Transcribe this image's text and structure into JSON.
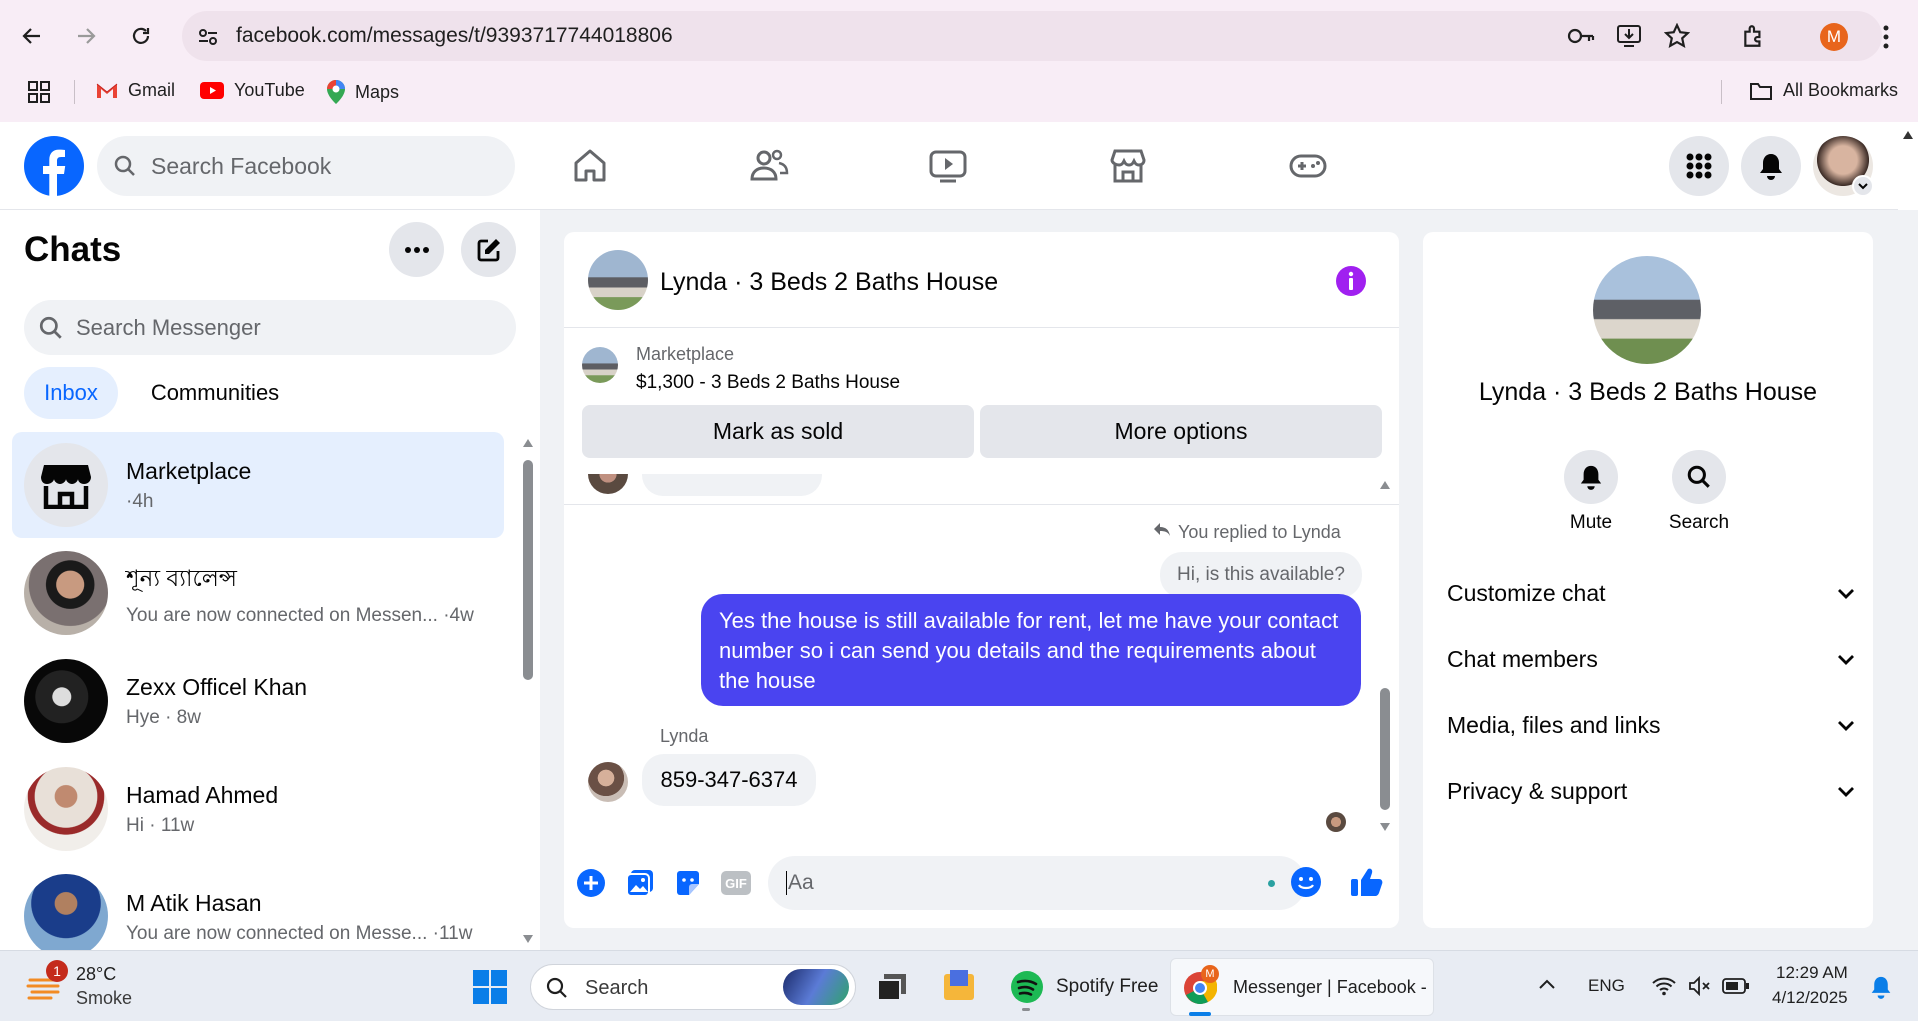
{
  "browser": {
    "url": "facebook.com/messages/t/9393717744018806",
    "profile_initial": "M",
    "bookmarks": [
      {
        "label": "Gmail"
      },
      {
        "label": "YouTube"
      },
      {
        "label": "Maps"
      }
    ],
    "all_bookmarks": "All Bookmarks"
  },
  "fb": {
    "search_placeholder": "Search Facebook"
  },
  "chats": {
    "title": "Chats",
    "search_placeholder": "Search Messenger",
    "tabs": [
      {
        "label": "Inbox"
      },
      {
        "label": "Communities"
      }
    ],
    "items": [
      {
        "name": "Marketplace",
        "sub": "·4h"
      },
      {
        "name": "শূন্য ব্যালেন্স",
        "sub": "You are now connected on Messen... ·4w"
      },
      {
        "name": "Zexx Officel Khan",
        "sub": "Hye · 8w"
      },
      {
        "name": "Hamad Ahmed",
        "sub": "Hi · 11w"
      },
      {
        "name": "M Atik Hasan",
        "sub": "You are now connected on Messe... ·11w"
      }
    ]
  },
  "conversation": {
    "title": "Lynda · 3 Beds 2 Baths House",
    "marketplace_label": "Marketplace",
    "listing": "$1,300 - 3 Beds 2 Baths House",
    "mark_sold": "Mark as sold",
    "more_options": "More options",
    "replied_label": "You replied to Lynda",
    "quoted_message": "Hi, is this available?",
    "my_message": "Yes the house is still available for rent, let me have your contact number so i can send you details and the requirements about the house",
    "sender_label": "Lynda",
    "their_message": "859-347-6374",
    "composer_placeholder": "Aa",
    "gif_label": "GIF"
  },
  "details": {
    "title": "Lynda · 3 Beds 2 Baths House",
    "mute": "Mute",
    "search": "Search",
    "sections": [
      {
        "label": "Customize chat"
      },
      {
        "label": "Chat members"
      },
      {
        "label": "Media, files and links"
      },
      {
        "label": "Privacy & support"
      }
    ]
  },
  "taskbar": {
    "temp": "28°C",
    "weather": "Smoke",
    "weather_badge": "1",
    "search": "Search",
    "spotify": "Spotify Free",
    "messenger": "Messenger | Facebook -",
    "lang": "ENG",
    "time": "12:29 AM",
    "date": "4/12/2025"
  },
  "colors": {
    "fb_blue": "#0866ff",
    "my_bubble": "#4a44f0",
    "info_purple": "#a020f0"
  }
}
